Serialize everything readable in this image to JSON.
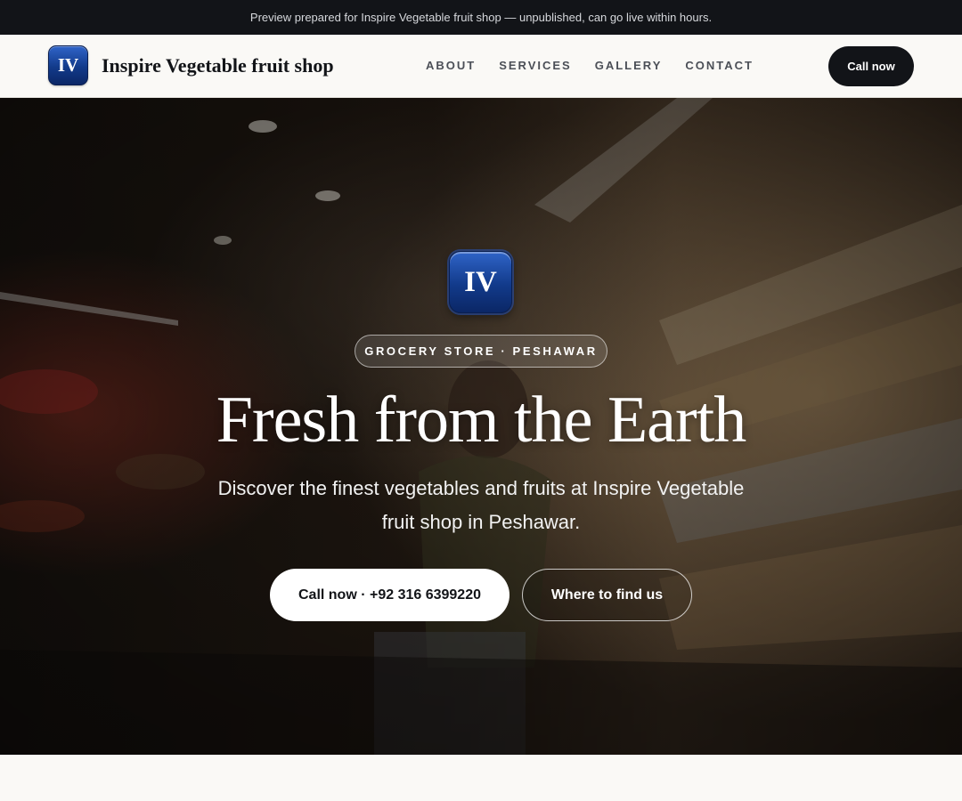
{
  "banner": {
    "text": "Preview prepared for Inspire Vegetable fruit shop — unpublished, can go live within hours."
  },
  "header": {
    "logo_text": "IV",
    "brand_name": "Inspire Vegetable fruit shop",
    "nav": [
      {
        "label": "ABOUT"
      },
      {
        "label": "SERVICES"
      },
      {
        "label": "GALLERY"
      },
      {
        "label": "CONTACT"
      }
    ],
    "cta_label": "Call now"
  },
  "hero": {
    "logo_text": "IV",
    "tagline": "GROCERY STORE · PESHAWAR",
    "title": "Fresh from the Earth",
    "subtitle": "Discover the finest vegetables and fruits at Inspire Vegetable fruit shop in Peshawar.",
    "primary_button": "Call now · +92 316 6399220",
    "secondary_button": "Where to find us",
    "background_image": "grocery-aisle-photo"
  },
  "colors": {
    "dark": "#121418",
    "logo_blue": "#123a8a",
    "page_bg": "#faf9f6"
  }
}
